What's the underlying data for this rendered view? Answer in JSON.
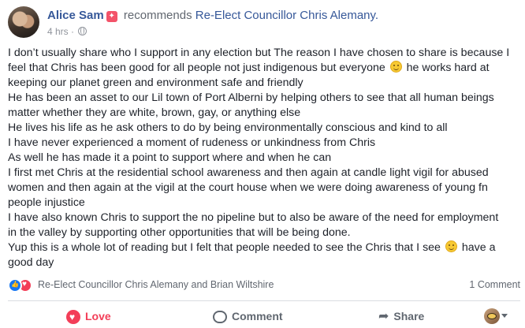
{
  "header": {
    "author": "Alice Sam",
    "recommend_icon": "recommendation-badge-icon",
    "verb": "recommends",
    "page_name": "Re-Elect Councillor Chris Alemany.",
    "time": "4 hrs",
    "separator": "·",
    "audience_icon": "globe-icon"
  },
  "body": {
    "lines": [
      {
        "before": "I don’t usually share who I support in any election but The reason I have chosen to share is because I"
      },
      {
        "before": "feel that Chris has been good for all people not just indigenous but everyone",
        "emoji": "smiley-emoji",
        "after": "he works hard at"
      },
      {
        "before": "keeping our planet green and environment safe and friendly"
      },
      {
        "before": "He has been an asset to our Lil town of Port Alberni by helping others to see that all human beings"
      },
      {
        "before": "matter whether they are white, brown, gay, or anything else"
      },
      {
        "before": "He lives his life as he ask others to do by being environmentally conscious and kind to all"
      },
      {
        "before": "I have never experienced a moment of rudeness or unkindness from Chris"
      },
      {
        "before": "As well he has made it a point to support where and when he can"
      },
      {
        "before": "I first met Chris at the residential school awareness and then again at candle light vigil for abused"
      },
      {
        "before": "women and then again at the vigil at the court house when we were doing awareness of young fn"
      },
      {
        "before": "people injustice"
      },
      {
        "before": "I have also known Chris to support the no pipeline but to also be aware of the need for employment"
      },
      {
        "before": "in the valley by supporting other opportunities that will be being done."
      },
      {
        "before": "Yup this is a whole lot of reading but I felt that people needed to see the Chris that I see",
        "emoji": "smiley-emoji",
        "after": "have a"
      },
      {
        "before": "good day"
      }
    ]
  },
  "reactions": {
    "icons": [
      "like-reaction-icon",
      "love-reaction-icon"
    ],
    "names": "Re-Elect Councillor Chris Alemany and Brian Wiltshire",
    "comment_count": "1 Comment"
  },
  "actions": {
    "love_label": "Love",
    "comment_label": "Comment",
    "share_label": "Share"
  },
  "colors": {
    "link": "#365899",
    "love": "#f33e58",
    "like": "#1877f2",
    "muted": "#616770"
  }
}
